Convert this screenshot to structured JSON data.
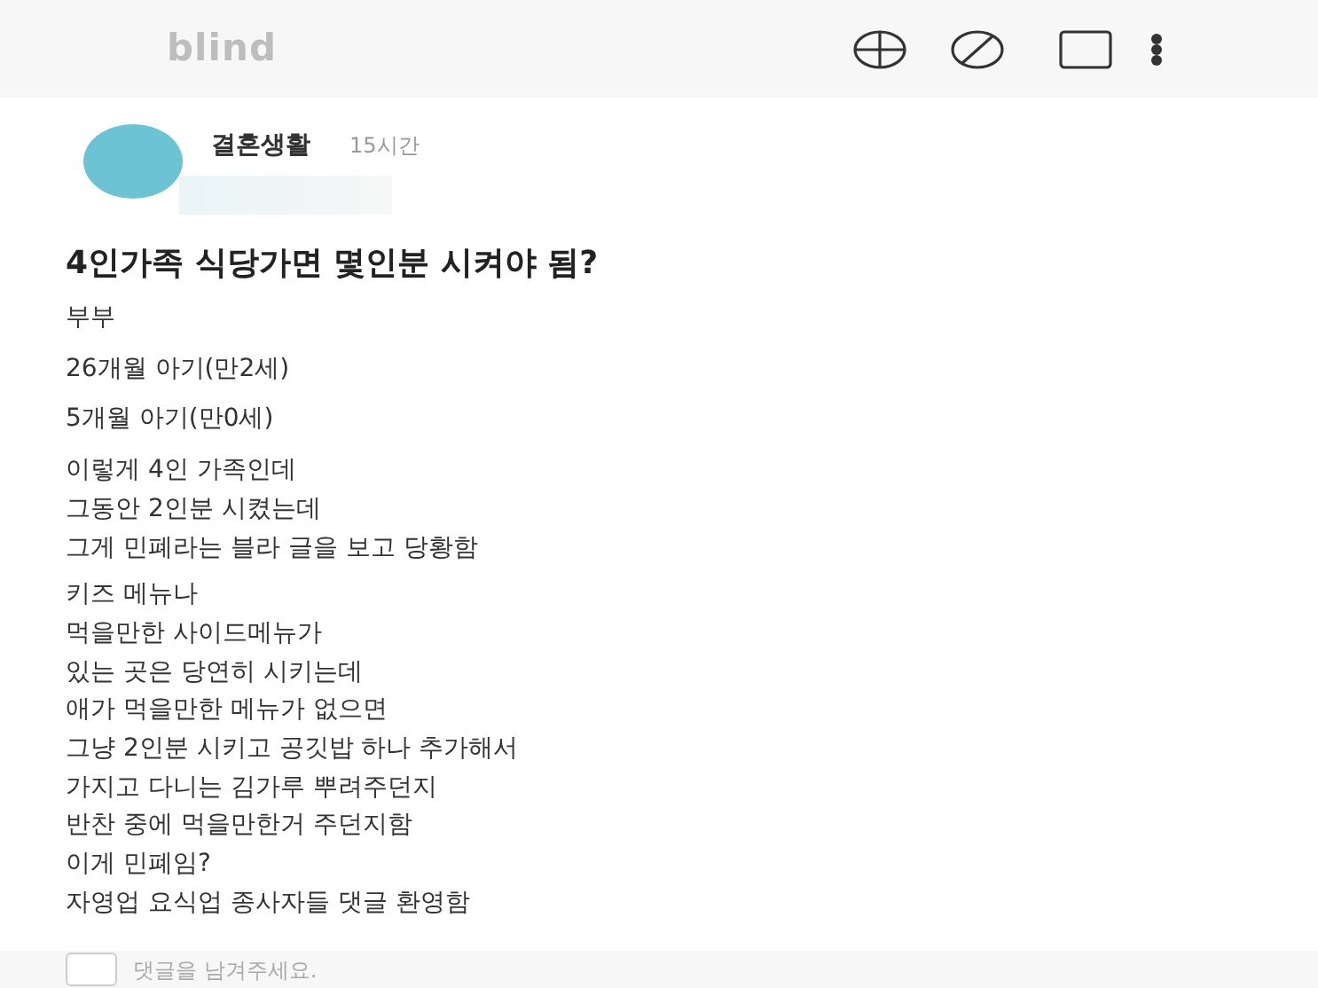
{
  "header": {
    "logo": "blind"
  },
  "post": {
    "category": "결혼생활",
    "time": "15시간",
    "title": "4인가족 식당가면 몇인분 시켜야 됨?",
    "paragraphs": [
      [
        "부부"
      ],
      [
        "26개월 아기(만2세)"
      ],
      [
        "5개월 아기(만0세)"
      ],
      [
        "이렇게 4인 가족인데",
        "그동안 2인분 시켰는데",
        "그게 민폐라는 블라 글을 보고 당황함"
      ],
      [
        "키즈 메뉴나",
        "먹을만한 사이드메뉴가",
        "있는 곳은 당연히 시키는데",
        "애가 먹을만한 메뉴가 없으면",
        "그냥 2인분 시키고 공깃밥 하나 추가해서",
        "가지고 다니는 김가루 뿌려주던지",
        "반찬 중에 먹을만한거 주던지함",
        "이게 민폐임?",
        "자영업 요식업 종사자들 댓글 환영함"
      ]
    ]
  },
  "comment_field": {
    "placeholder": "댓글을 남겨주세요."
  }
}
